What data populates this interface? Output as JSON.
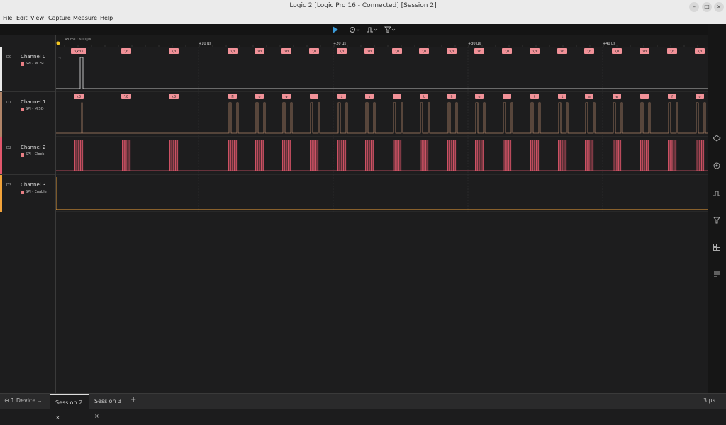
{
  "window": {
    "title": "Logic 2 [Logic Pro 16 - Connected] [Session 2]"
  },
  "menu": [
    "File",
    "Edit",
    "View",
    "Capture",
    "Measure",
    "Help"
  ],
  "timeline": {
    "origin_label": "48 ms : 600 µs",
    "ticks": [
      "+10 µs",
      "+20 µs",
      "+30 µs",
      "+40 µs"
    ]
  },
  "channels": [
    {
      "num": "D0",
      "name": "Channel 0",
      "analyzer": "SPI - MOSI",
      "color": "#e9e9e9"
    },
    {
      "num": "D1",
      "name": "Channel 1",
      "analyzer": "SPI - MISO",
      "color": "#b08468"
    },
    {
      "num": "D2",
      "name": "Channel 2",
      "analyzer": "SPI - Clock",
      "color": "#e2576c"
    },
    {
      "num": "D3",
      "name": "Channel 3",
      "analyzer": "SPI - Enable",
      "color": "#f2a33a"
    }
  ],
  "mosi_bytes": [
    "\\x03",
    "\\0",
    "\\0",
    "\\0",
    "\\0",
    "\\0",
    "\\0",
    "\\0",
    "\\0",
    "\\0",
    "\\0",
    "\\0",
    "\\0",
    "\\0",
    "\\0",
    "\\0",
    "\\0",
    "\\0",
    "\\0",
    "\\0",
    "\\0",
    "\\0",
    "\\0"
  ],
  "miso_bytes": [
    "\\0",
    "\\0",
    "\\0",
    "N",
    "o",
    "w",
    " ",
    "i",
    "s",
    " ",
    "t",
    "h",
    "e",
    " ",
    "t",
    "i",
    "m",
    "e",
    " ",
    "f",
    "o"
  ],
  "status": {
    "device": "1 Device",
    "tabs": [
      "Session 2",
      "Session 3"
    ],
    "add": "+",
    "close": "×",
    "right": "3 µs"
  },
  "icons": {
    "play": "play-icon",
    "settings": "settings-icon",
    "trigger": "trigger-icon",
    "filter": "filter-icon"
  }
}
